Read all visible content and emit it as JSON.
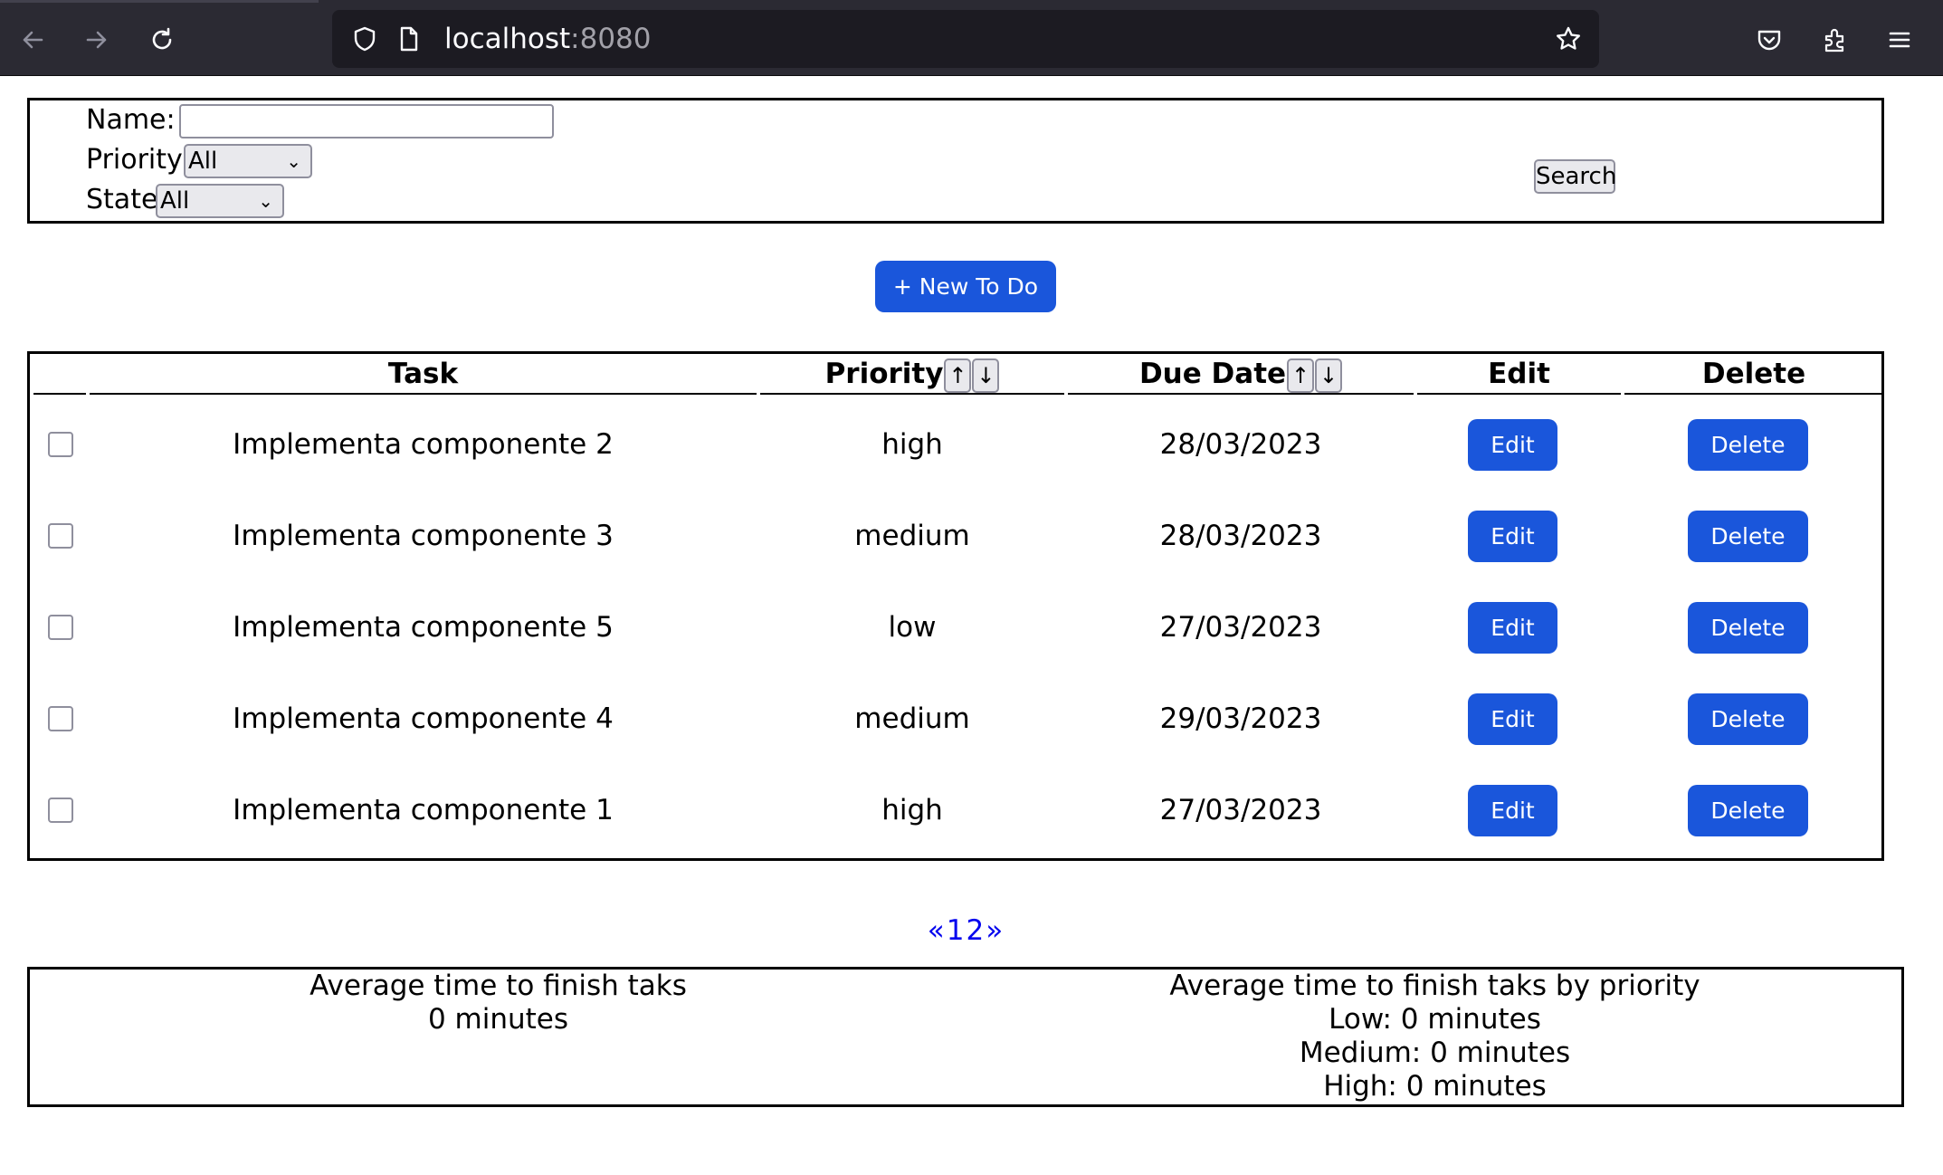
{
  "browser": {
    "url_host": "localhost",
    "url_port": ":8080"
  },
  "filters": {
    "name_label": "Name:",
    "name_value": "",
    "priority_label": "Priority",
    "priority_selected": "All",
    "state_label": "State",
    "state_selected": "All",
    "search_label": "Search"
  },
  "new_todo_label": "+ New To Do",
  "table": {
    "headers": {
      "task": "Task",
      "priority": "Priority",
      "due_date": "Due Date",
      "edit": "Edit",
      "delete": "Delete",
      "sort_up": "↑",
      "sort_down": "↓"
    },
    "rows": [
      {
        "checked": false,
        "task": "Implementa componente 2",
        "priority": "high",
        "due": "28/03/2023",
        "edit": "Edit",
        "delete": "Delete"
      },
      {
        "checked": false,
        "task": "Implementa componente 3",
        "priority": "medium",
        "due": "28/03/2023",
        "edit": "Edit",
        "delete": "Delete"
      },
      {
        "checked": false,
        "task": "Implementa componente 5",
        "priority": "low",
        "due": "27/03/2023",
        "edit": "Edit",
        "delete": "Delete"
      },
      {
        "checked": false,
        "task": "Implementa componente 4",
        "priority": "medium",
        "due": "29/03/2023",
        "edit": "Edit",
        "delete": "Delete"
      },
      {
        "checked": false,
        "task": "Implementa componente 1",
        "priority": "high",
        "due": "27/03/2023",
        "edit": "Edit",
        "delete": "Delete"
      }
    ]
  },
  "pagination": {
    "prev": "«",
    "pages": [
      "1",
      "2"
    ],
    "next": "»"
  },
  "stats": {
    "avg_title": "Average time to finish taks",
    "avg_value": "0 minutes",
    "by_priority_title": "Average time to finish taks by priority",
    "low": "Low: 0 minutes",
    "medium": "Medium: 0 minutes",
    "high": "High: 0 minutes"
  },
  "colors": {
    "accent": "#1a56db",
    "link": "#0000ee",
    "chrome_bg": "#2b2a33",
    "urlbar_bg": "#1c1b22"
  }
}
